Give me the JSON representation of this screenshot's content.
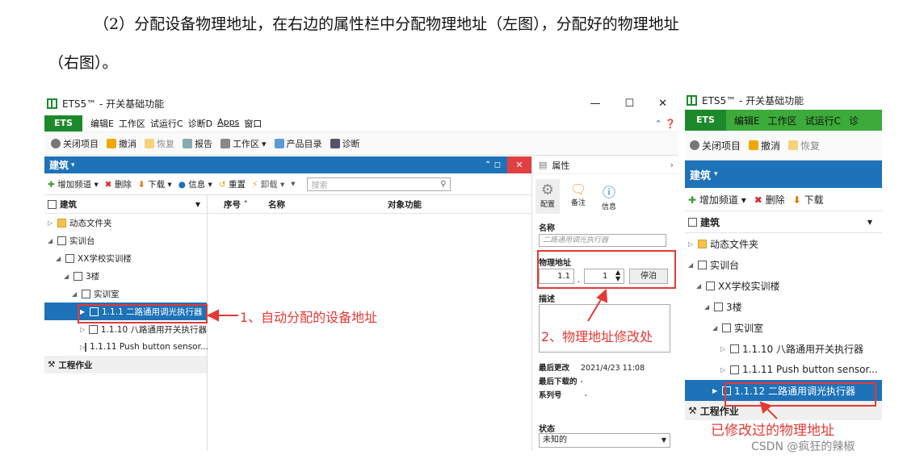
{
  "paragraph": {
    "line1": "（2）分配设备物理地址，在右边的属性栏中分配物理地址（左图），分配好的物理地址",
    "line2": "（右图）。"
  },
  "window": {
    "title": "ETS5™ - 开关基础功能",
    "min": "—",
    "max": "☐",
    "close": "✕",
    "ets_tab": "ETS",
    "menus": [
      "编辑E",
      "工作区",
      "试运行C",
      "诊断D",
      "Apps",
      "窗口"
    ],
    "help": "⌃ ❓",
    "toolbar": [
      "关闭项目",
      "撤消",
      "恢复",
      "报告",
      "工作区",
      "产品目录",
      "诊断"
    ],
    "panel_title": "建筑",
    "panel_ctrl": "⌃  ◻",
    "panel_close": "✕",
    "subtoolbar": [
      "增加频道",
      "删除",
      "下载",
      "信息",
      "重置",
      "卸载"
    ],
    "search_placeholder": "搜索",
    "tree_header": "建筑",
    "tree": [
      "动态文件夹",
      "实训台",
      "XX学校实训楼",
      "3楼",
      "实训室",
      "1.1.1 二路通用调光执行器",
      "1.1.10 八路通用开关执行器",
      "1.1.11 Push button sensor..."
    ],
    "work": "工程作业",
    "columns": [
      "序号 ˄",
      "名称",
      "对象功能"
    ],
    "props": {
      "title": "属性",
      "tabs": [
        "配置",
        "备注",
        "信息"
      ],
      "name_label": "名称",
      "name_placeholder": "二路通用调光执行器",
      "addr_label": "物理地址",
      "addr_a": "1.1",
      "addr_b": "1",
      "park": "停泊",
      "desc_label": "描述",
      "last_mod_label": "最后更改",
      "last_mod": "2021/4/23 11:08",
      "last_dl_label": "最后下载的",
      "last_dl": "-",
      "serial_label": "系列号",
      "serial": "-",
      "status_label": "状态",
      "status": "未知的"
    }
  },
  "window2": {
    "title": "ETS5™ - 开关基础功能",
    "ets_tab": "ETS",
    "menus": [
      "编辑E",
      "工作区",
      "试运行C",
      "诊"
    ],
    "toolbar": [
      "关闭项目",
      "撤消",
      "恢复"
    ],
    "panel_title": "建筑",
    "subtoolbar": [
      "增加频道",
      "删除",
      "下载"
    ],
    "tree_header": "建筑",
    "tree": [
      "动态文件夹",
      "实训台",
      "XX学校实训楼",
      "3楼",
      "实训室",
      "1.1.10 八路通用开关执行器",
      "1.1.11 Push button sensor...",
      "1.1.12 二路通用调光执行器"
    ],
    "work": "工程作业"
  },
  "annotations": {
    "a1": "1、自动分配的设备地址",
    "a2": "2、物理地址修改处",
    "a3": "已修改过的物理地址"
  },
  "watermark": "CSDN @疯狂的辣椒",
  "colors": {
    "green": "#3cab3a",
    "blue": "#1e72b8",
    "red": "#e53935"
  }
}
